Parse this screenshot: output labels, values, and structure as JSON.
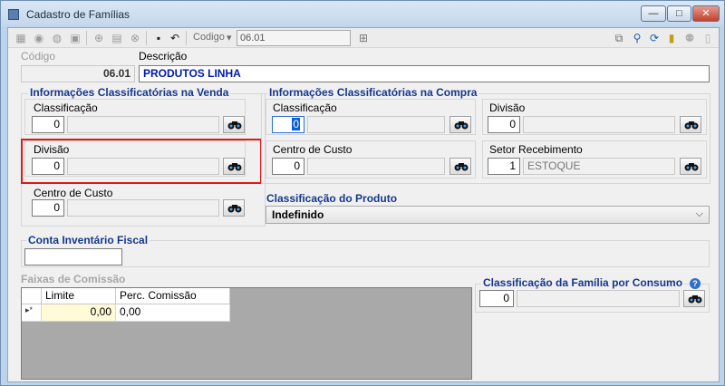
{
  "window": {
    "title": "Cadastro de Famílias",
    "minimize": "—",
    "maximize": "□",
    "close": "✕"
  },
  "toolbar": {
    "codigo_label": "Codigo",
    "codigo_arrow": "▾",
    "codigo_value": "06.01",
    "icons": [
      "new-icon",
      "edit-icon",
      "print-icon",
      "delete-icon",
      "add-icon",
      "clone-icon",
      "cancel-icon",
      "save-icon",
      "undo-icon",
      "search-icon",
      "toolbar-right-icons"
    ]
  },
  "header": {
    "codigo_label": "Código",
    "codigo_value": "06.01",
    "descricao_label": "Descrição",
    "descricao_value": "PRODUTOS LINHA"
  },
  "venda": {
    "title": "Informações Classificatórias na Venda",
    "classificacao": {
      "label": "Classificação",
      "value": "0",
      "desc": ""
    },
    "divisao": {
      "label": "Divisão",
      "value": "0",
      "desc": ""
    },
    "centro_custo": {
      "label": "Centro de Custo",
      "value": "0",
      "desc": ""
    }
  },
  "compra": {
    "title": "Informações Classificatórias na Compra",
    "classificacao": {
      "label": "Classificação",
      "value": "0",
      "desc": ""
    },
    "divisao": {
      "label": "Divisão",
      "value": "0",
      "desc": ""
    },
    "centro_custo": {
      "label": "Centro de Custo",
      "value": "0",
      "desc": ""
    },
    "setor_recebimento": {
      "label": "Setor Recebimento",
      "value": "1",
      "desc": "ESTOQUE"
    }
  },
  "produto": {
    "title": "Classificação do Produto",
    "selected": "Indefinido"
  },
  "conta": {
    "title": "Conta Inventário Fiscal",
    "value": ""
  },
  "faixas": {
    "title": "Faixas de Comissão",
    "columns": [
      "Limite",
      "Perc. Comissão"
    ],
    "rows": [
      {
        "indicator": "▸*",
        "limite": "0,00",
        "perc": "0,00"
      }
    ]
  },
  "consumo": {
    "title": "Classificação da Família por Consumo",
    "value": "0",
    "desc": "",
    "help": "?"
  },
  "colors": {
    "group_title": "#16378c",
    "highlight": "#e01818",
    "accent_input": "#fffbd6"
  }
}
